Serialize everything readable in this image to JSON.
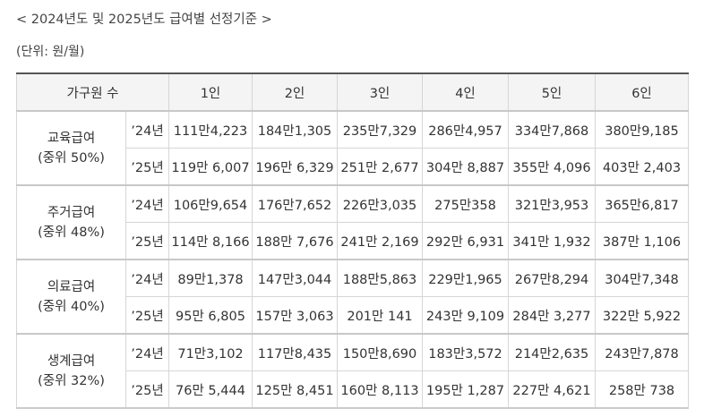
{
  "title": "< 2024년도 및 2025년도 급여별 선정기준 >",
  "unit": "(단위: 원/월)",
  "header": [
    "가구원 수",
    "1인",
    "2인",
    "3인",
    "4인",
    "5인",
    "6인"
  ],
  "groups": [
    {
      "name": "교육급여",
      "sub": "(중위 50%)",
      "rows": [
        {
          "year": "’24년",
          "values": [
            "111만4,223",
            "184만1,305",
            "235만7,329",
            "286만4,957",
            "334만7,868",
            "380만9,185"
          ]
        },
        {
          "year": "’25년",
          "values": [
            "119만 6,007",
            "196만 6,329",
            "251만 2,677",
            "304만 8,887",
            "355만 4,096",
            "403만 2,403"
          ]
        }
      ]
    },
    {
      "name": "주거급여",
      "sub": "(중위 48%)",
      "rows": [
        {
          "year": "’24년",
          "values": [
            "106만9,654",
            "176만7,652",
            "226만3,035",
            "275만358",
            "321만3,953",
            "365만6,817"
          ]
        },
        {
          "year": "’25년",
          "values": [
            "114만 8,166",
            "188만 7,676",
            "241만 2,169",
            "292만 6,931",
            "341만 1,932",
            "387만 1,106"
          ]
        }
      ]
    },
    {
      "name": "의료급여",
      "sub": "(중위 40%)",
      "rows": [
        {
          "year": "’24년",
          "values": [
            "89만1,378",
            "147만3,044",
            "188만5,863",
            "229만1,965",
            "267만8,294",
            "304만7,348"
          ]
        },
        {
          "year": "’25년",
          "values": [
            "95만 6,805",
            "157만 3,063",
            "201만 141",
            "243만 9,109",
            "284만 3,277",
            "322만 5,922"
          ]
        }
      ]
    },
    {
      "name": "생계급여",
      "sub": "(중위 32%)",
      "rows": [
        {
          "year": "’24년",
          "values": [
            "71만3,102",
            "117만8,435",
            "150만8,690",
            "183만3,572",
            "214만2,635",
            "243만7,878"
          ]
        },
        {
          "year": "’25년",
          "values": [
            "76만 5,444",
            "125만 8,451",
            "160만 8,113",
            "195만 1,287",
            "227만 4,621",
            "258만 738"
          ]
        }
      ]
    }
  ]
}
